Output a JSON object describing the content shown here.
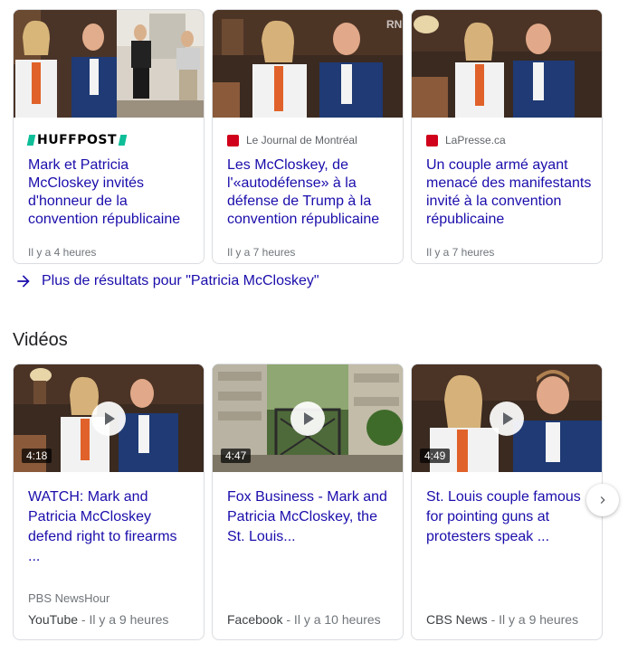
{
  "news": [
    {
      "source": "HUFFPOST",
      "title": "Mark et Patricia McCloskey invités d'honneur de la convention républicaine",
      "time": "Il y a 4 heures"
    },
    {
      "source": "Le Journal de Montréal",
      "title": "Les McCloskey, de l'«autodéfense» à la défense de Trump à la convention républicaine",
      "time": "Il y a 7 heures"
    },
    {
      "source": "LaPresse.ca",
      "title": "Un couple armé ayant menacé des manifestants invité à la convention républicaine",
      "time": "Il y a 7 heures"
    }
  ],
  "more_results": "Plus de résultats pour \"Patricia McCloskey\"",
  "videos_heading": "Vidéos",
  "videos": [
    {
      "duration": "4:18",
      "title": "WATCH: Mark and Patricia McCloskey defend right to firearms ...",
      "channel": "PBS NewsHour",
      "platform": "YouTube",
      "time": " - Il y a 9 heures"
    },
    {
      "duration": "4:47",
      "title": "Fox Business - Mark and Patricia McCloskey, the St. Louis...",
      "channel": "",
      "platform": "Facebook",
      "time": " - Il y a 10 heures"
    },
    {
      "duration": "4:49",
      "title": "St. Louis couple famous for pointing guns at protesters speak ...",
      "channel": "",
      "platform": "CBS News",
      "time": " - Il y a 9 heures"
    }
  ],
  "thumb_watermark": "RN",
  "colors": {
    "link": "#1a0dab",
    "meta": "#70757a",
    "border": "#dadce0",
    "huffpost_green": "#0dbe98",
    "favicon_red": "#d0021b"
  }
}
